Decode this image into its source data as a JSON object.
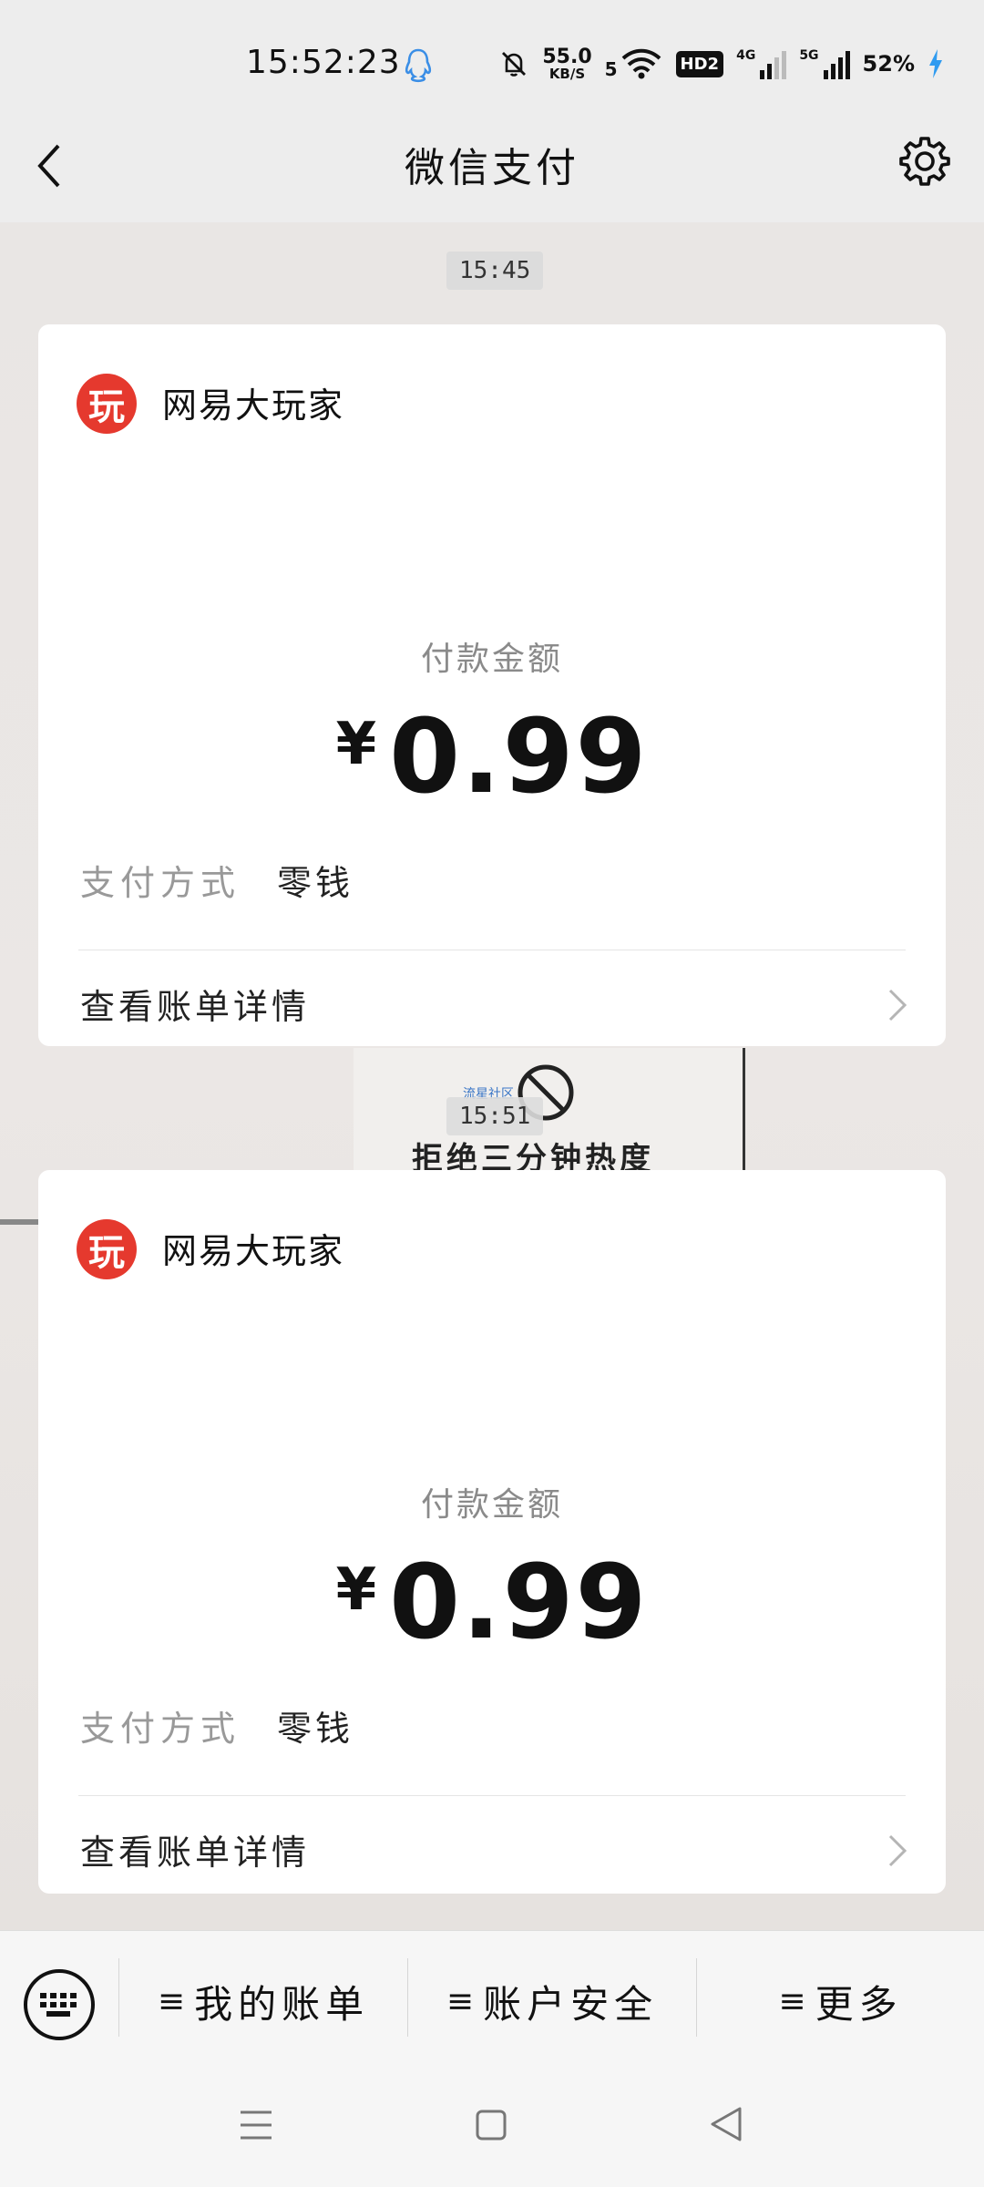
{
  "status_bar": {
    "time": "15:52:23",
    "net_speed_value": "55.0",
    "net_speed_unit": "KB/S",
    "wifi_label": "5",
    "hd_label": "HD2",
    "signal1_label": "4G",
    "signal2_label": "5G",
    "battery": "52%"
  },
  "header": {
    "title": "微信支付"
  },
  "background": {
    "poster_text": "拒绝三分钟热度",
    "poster_small": "流星社区"
  },
  "messages": [
    {
      "time": "15:45",
      "merchant": "网易大玩家",
      "logo_char": "玩",
      "amount_label": "付款金额",
      "currency": "¥",
      "amount": "0.99",
      "pay_method_label": "支付方式",
      "pay_method_value": "零钱",
      "detail_link": "查看账单详情"
    },
    {
      "time": "15:51",
      "merchant": "网易大玩家",
      "logo_char": "玩",
      "amount_label": "付款金额",
      "currency": "¥",
      "amount": "0.99",
      "pay_method_label": "支付方式",
      "pay_method_value": "零钱",
      "detail_link": "查看账单详情"
    }
  ],
  "bottom_menu": {
    "menu_glyph": "≡",
    "items": [
      {
        "label": "我的账单"
      },
      {
        "label": "账户安全"
      },
      {
        "label": "更多"
      }
    ]
  },
  "icons": [
    "qq-icon",
    "mute-icon",
    "wifi-icon",
    "back-icon",
    "settings-icon",
    "keyboard-icon",
    "chevron-right-icon",
    "sys-menu-icon",
    "sys-home-icon",
    "sys-back-icon"
  ],
  "colors": {
    "logo_red": "#e5392e",
    "qq_blue": "#3a8ee6",
    "charging_blue": "#2f9bf0"
  }
}
